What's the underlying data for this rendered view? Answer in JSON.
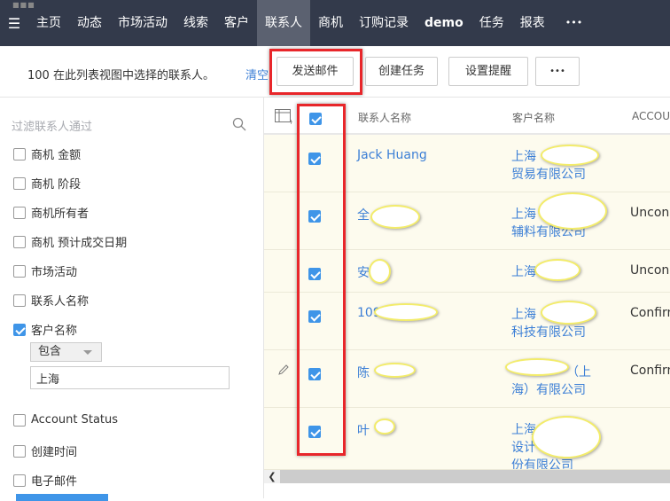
{
  "nav": {
    "tabs": [
      "主页",
      "动态",
      "市场活动",
      "线索",
      "客户",
      "联系人",
      "商机",
      "订购记录",
      "demo",
      "任务",
      "报表"
    ],
    "active": "联系人",
    "more": "•••"
  },
  "toolbar": {
    "message": "100 在此列表视图中选择的联系人。",
    "clear": "清空",
    "send_email": "发送邮件",
    "create_task": "创建任务",
    "set_reminder": "设置提醒",
    "more": "•••"
  },
  "sidebar": {
    "filter_placeholder": "过滤联系人通过",
    "items": [
      {
        "label": "商机 金额",
        "checked": false
      },
      {
        "label": "商机 阶段",
        "checked": false
      },
      {
        "label": "商机所有者",
        "checked": false
      },
      {
        "label": "商机 预计成交日期",
        "checked": false
      },
      {
        "label": "市场活动",
        "checked": false
      },
      {
        "label": "联系人名称",
        "checked": false
      },
      {
        "label": "客户名称",
        "checked": true
      }
    ],
    "condition": "包含",
    "condition_value": "上海",
    "items2": [
      {
        "label": "Account Status",
        "checked": false
      },
      {
        "label": "创建时间",
        "checked": false
      },
      {
        "label": "电子邮件",
        "checked": false
      }
    ]
  },
  "table": {
    "headers": [
      "联系人名称",
      "客户名称",
      "ACCOU"
    ],
    "rows": [
      {
        "name": "Jack Huang",
        "customer": [
          "上海",
          "贸易有限公司"
        ],
        "status": ""
      },
      {
        "name": "全",
        "customer": [
          "上海",
          "辅料有限公司"
        ],
        "status": "Uncon"
      },
      {
        "name": "安",
        "customer": [
          "上海"
        ],
        "status": "Uncon"
      },
      {
        "name": "109",
        "customer": [
          "上海",
          "科技有限公司"
        ],
        "status": "Confirm"
      },
      {
        "name": "陈",
        "customer": [
          "（上",
          "海）有限公司"
        ],
        "status": "Confirm"
      },
      {
        "name": "叶",
        "customer": [
          "上海",
          "设计",
          "份有限公司"
        ],
        "status": ""
      }
    ]
  },
  "colors": {
    "nav_bg": "#333a4b",
    "accent": "#3f95e8",
    "link": "#3c7fd6",
    "highlight": "#e8262a",
    "row_bg": "#fdfbee"
  }
}
